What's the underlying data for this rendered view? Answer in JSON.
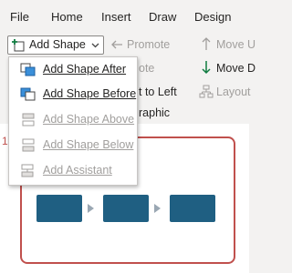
{
  "menubar": {
    "items": [
      "File",
      "Home",
      "Insert",
      "Draw",
      "Design"
    ]
  },
  "ribbon": {
    "add_shape_label": "Add Shape",
    "promote_label": "Promote",
    "demote_label": "ote",
    "right_to_left_label": "t to Left",
    "graphic_label": "raphic",
    "move_up_label": "Move U",
    "move_down_label": "Move D",
    "layout_label": "Layout"
  },
  "dropdown": {
    "items": [
      {
        "label": "Add Shape After",
        "enabled": true
      },
      {
        "label": "Add Shape Before",
        "enabled": true
      },
      {
        "label": "Add Shape Above",
        "enabled": false
      },
      {
        "label": "Add Shape Below",
        "enabled": false
      },
      {
        "label": "Add Assistant",
        "enabled": false
      }
    ]
  },
  "canvas": {
    "slide_number": "1"
  },
  "colors": {
    "accent_frame": "#c0504d",
    "box_fill": "#1f5f82",
    "green_arrow": "#107c41"
  }
}
